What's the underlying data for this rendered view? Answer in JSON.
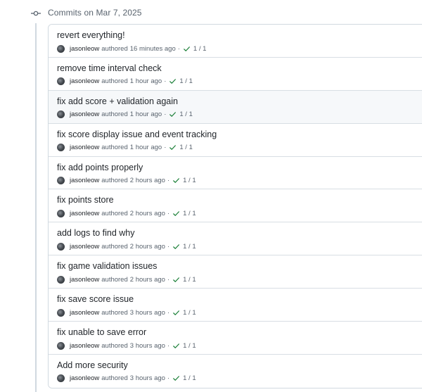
{
  "header": {
    "title": "Commits on Mar 7, 2025"
  },
  "colors": {
    "check": "#1a7f37",
    "muted": "#59636e",
    "border": "#d1d9e0",
    "highlight_row": "#f6f8fa"
  },
  "commits": [
    {
      "title": "revert everything!",
      "author": "jasonleow",
      "authored": "authored",
      "time": "16 minutes ago",
      "separator": "·",
      "status": "1 / 1"
    },
    {
      "title": "remove time interval check",
      "author": "jasonleow",
      "authored": "authored",
      "time": "1 hour ago",
      "separator": "·",
      "status": "1 / 1"
    },
    {
      "title": "fix add score + validation again",
      "author": "jasonleow",
      "authored": "authored",
      "time": "1 hour ago",
      "separator": "·",
      "status": "1 / 1"
    },
    {
      "title": "fix score display issue and event tracking",
      "author": "jasonleow",
      "authored": "authored",
      "time": "1 hour ago",
      "separator": "·",
      "status": "1 / 1"
    },
    {
      "title": "fix add points properly",
      "author": "jasonleow",
      "authored": "authored",
      "time": "2 hours ago",
      "separator": "·",
      "status": "1 / 1"
    },
    {
      "title": "fix points store",
      "author": "jasonleow",
      "authored": "authored",
      "time": "2 hours ago",
      "separator": "·",
      "status": "1 / 1"
    },
    {
      "title": "add logs to find why",
      "author": "jasonleow",
      "authored": "authored",
      "time": "2 hours ago",
      "separator": "·",
      "status": "1 / 1"
    },
    {
      "title": "fix game validation issues",
      "author": "jasonleow",
      "authored": "authored",
      "time": "2 hours ago",
      "separator": "·",
      "status": "1 / 1"
    },
    {
      "title": "fix save score issue",
      "author": "jasonleow",
      "authored": "authored",
      "time": "3 hours ago",
      "separator": "·",
      "status": "1 / 1"
    },
    {
      "title": "fix unable to save error",
      "author": "jasonleow",
      "authored": "authored",
      "time": "3 hours ago",
      "separator": "·",
      "status": "1 / 1"
    },
    {
      "title": "Add more security",
      "author": "jasonleow",
      "authored": "authored",
      "time": "3 hours ago",
      "separator": "·",
      "status": "1 / 1"
    }
  ]
}
